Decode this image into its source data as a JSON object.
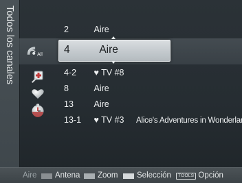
{
  "screen_title": "Todos los canales",
  "icons": [
    {
      "name": "antenna-air-icon",
      "label": "All"
    },
    {
      "name": "add-channel-icon"
    },
    {
      "name": "favorite-heart-icon"
    },
    {
      "name": "timer-clock-icon"
    }
  ],
  "channels": [
    {
      "number": "2",
      "name": "Aire",
      "program": "",
      "fav": false
    },
    {
      "number": "4",
      "name": "Aire",
      "program": "",
      "fav": false,
      "selected": true
    },
    {
      "number": "4-2",
      "name": "♥ TV #8",
      "program": "",
      "fav": true
    },
    {
      "number": "8",
      "name": "Aire",
      "program": "",
      "fav": false
    },
    {
      "number": "13",
      "name": "Aire",
      "program": "",
      "fav": false
    },
    {
      "number": "13-1",
      "name": "♥ TV #3",
      "program": "Alice's Adventures in Wonderland",
      "fav": true
    }
  ],
  "footer": {
    "mode": "Aire",
    "antenna": "Antena",
    "zoom": "Zoom",
    "select": "Selección",
    "tools_badge": "TOOLS",
    "option": "Opción"
  },
  "colors": {
    "red_button": "#b23a3a",
    "green_button": "#8a9a8e",
    "yellow_button": "#a8aeb1",
    "blue_button": "#d5d9db"
  }
}
